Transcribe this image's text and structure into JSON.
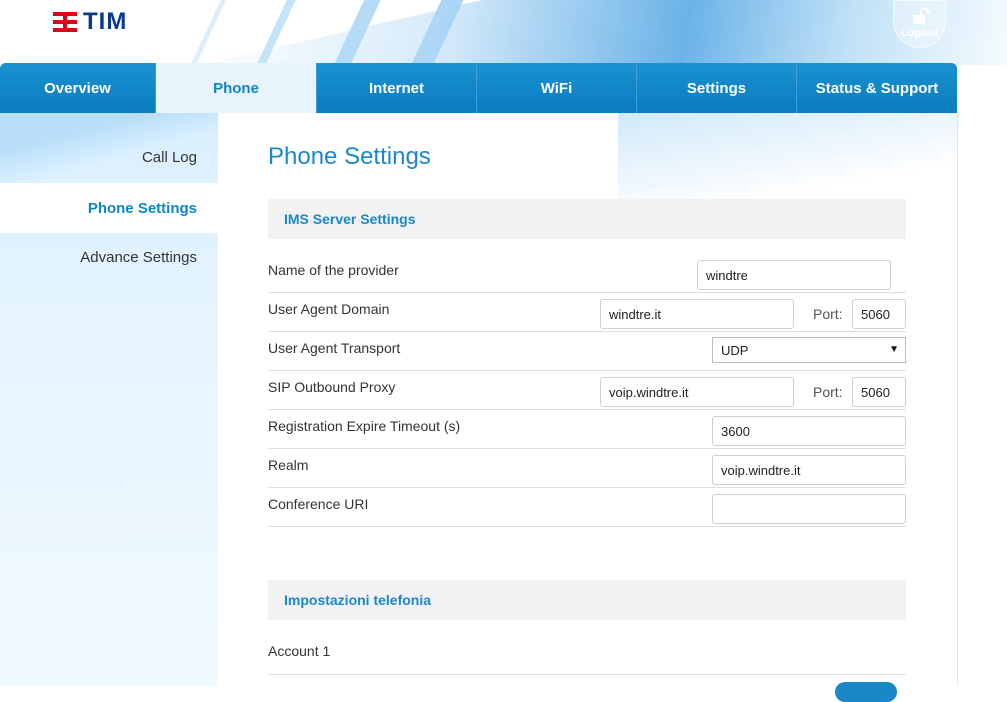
{
  "header": {
    "brand": "TIM",
    "logout_label": "Logout"
  },
  "nav": {
    "tabs": [
      {
        "label": "Overview"
      },
      {
        "label": "Phone"
      },
      {
        "label": "Internet"
      },
      {
        "label": "WiFi"
      },
      {
        "label": "Settings"
      },
      {
        "label": "Status & Support"
      }
    ],
    "active": "Phone"
  },
  "sidebar": {
    "items": [
      {
        "label": "Call Log"
      },
      {
        "label": "Phone Settings"
      },
      {
        "label": "Advance Settings"
      }
    ],
    "active": "Phone Settings"
  },
  "main": {
    "title": "Phone Settings",
    "ims_section": {
      "heading": "IMS Server Settings",
      "provider_label": "Name of the provider",
      "provider_value": "windtre",
      "ua_domain_label": "User Agent Domain",
      "ua_domain_value": "windtre.it",
      "ua_domain_port_label": "Port:",
      "ua_domain_port_value": "5060",
      "ua_transport_label": "User Agent Transport",
      "ua_transport_value": "UDP",
      "sip_proxy_label": "SIP Outbound Proxy",
      "sip_proxy_value": "voip.windtre.it",
      "sip_proxy_port_label": "Port:",
      "sip_proxy_port_value": "5060",
      "reg_timeout_label": "Registration Expire Timeout (s)",
      "reg_timeout_value": "3600",
      "realm_label": "Realm",
      "realm_value": "voip.windtre.it",
      "conference_label": "Conference URI",
      "conference_value": ""
    },
    "telefonia_section": {
      "heading": "Impostazioni telefonia",
      "account_label": "Account 1"
    }
  },
  "colors": {
    "accent": "#0d86c6",
    "brand_red": "#e2001a",
    "brand_blue": "#0a3a8c"
  }
}
